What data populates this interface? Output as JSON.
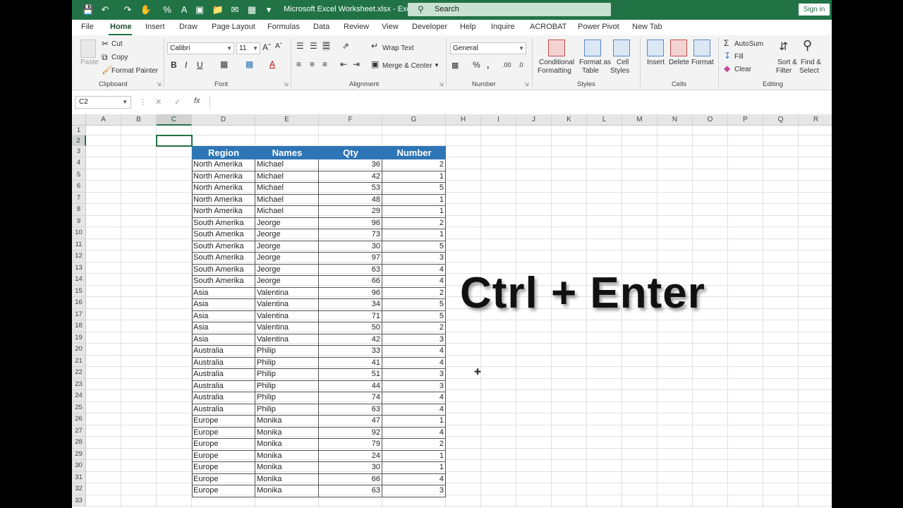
{
  "window": {
    "title": "Microsoft Excel Worksheet.xlsx  -  Excel",
    "search_placeholder": "Search",
    "signin_label": "Sign in"
  },
  "tabs": [
    "File",
    "Home",
    "Insert",
    "Draw",
    "Page Layout",
    "Formulas",
    "Data",
    "Review",
    "View",
    "Developer",
    "Help",
    "Inquire",
    "ACROBAT",
    "Power Pivot",
    "New Tab"
  ],
  "ribbon": {
    "clipboard": {
      "paste": "Paste",
      "cut": "Cut",
      "copy": "Copy",
      "format_painter": "Format Painter",
      "label": "Clipboard"
    },
    "font": {
      "name": "Calibri",
      "size": "11",
      "bold": "B",
      "italic": "I",
      "underline": "U",
      "label": "Font"
    },
    "alignment": {
      "wrap": "Wrap Text",
      "merge": "Merge & Center",
      "label": "Alignment"
    },
    "number": {
      "format": "General",
      "label": "Number"
    },
    "styles": {
      "conditional": "Conditional",
      "conditional2": "Formatting",
      "format_as": "Format as",
      "format_as2": "Table",
      "cell": "Cell",
      "cell2": "Styles",
      "label": "Styles"
    },
    "cells": {
      "insert": "Insert",
      "delete": "Delete",
      "format": "Format",
      "label": "Cells"
    },
    "editing": {
      "autosum": "AutoSum",
      "fill": "Fill",
      "clear": "Clear",
      "sort": "Sort &",
      "sort2": "Filter",
      "find": "Find &",
      "find2": "Select",
      "label": "Editing"
    }
  },
  "formula_bar": {
    "name_box": "C2",
    "fx": "fx",
    "value": ""
  },
  "columns": [
    "A",
    "B",
    "C",
    "D",
    "E",
    "F",
    "G",
    "H",
    "I",
    "J",
    "K",
    "L",
    "M",
    "N",
    "O",
    "P",
    "Q",
    "R"
  ],
  "rows": [
    "1",
    "2",
    "3",
    "4",
    "5",
    "6",
    "7",
    "8",
    "9",
    "10",
    "11",
    "12",
    "13",
    "14",
    "15",
    "16",
    "17",
    "18",
    "19",
    "20",
    "21",
    "22",
    "23",
    "24",
    "25",
    "26",
    "27",
    "28",
    "29",
    "30",
    "31",
    "32",
    "33"
  ],
  "table": {
    "headers": [
      "Region",
      "Names",
      "Qty",
      "Number"
    ],
    "rows": [
      [
        "North Amerika",
        "Michael",
        "36",
        "2"
      ],
      [
        "North Amerika",
        "Michael",
        "42",
        "1"
      ],
      [
        "North Amerika",
        "Michael",
        "53",
        "5"
      ],
      [
        "North Amerika",
        "Michael",
        "48",
        "1"
      ],
      [
        "North Amerika",
        "Michael",
        "29",
        "1"
      ],
      [
        "South Amerika",
        "Jeorge",
        "96",
        "2"
      ],
      [
        "South Amerika",
        "Jeorge",
        "73",
        "1"
      ],
      [
        "South Amerika",
        "Jeorge",
        "30",
        "5"
      ],
      [
        "South Amerika",
        "Jeorge",
        "97",
        "3"
      ],
      [
        "South Amerika",
        "Jeorge",
        "63",
        "4"
      ],
      [
        "South Amerika",
        "Jeorge",
        "66",
        "4"
      ],
      [
        "Asia",
        "Valentina",
        "96",
        "2"
      ],
      [
        "Asia",
        "Valentina",
        "34",
        "5"
      ],
      [
        "Asia",
        "Valentina",
        "71",
        "5"
      ],
      [
        "Asia",
        "Valentina",
        "50",
        "2"
      ],
      [
        "Asia",
        "Valentina",
        "42",
        "3"
      ],
      [
        "Australia",
        "Philip",
        "33",
        "4"
      ],
      [
        "Australia",
        "Philip",
        "41",
        "4"
      ],
      [
        "Australia",
        "Philip",
        "51",
        "3"
      ],
      [
        "Australia",
        "Philip",
        "44",
        "3"
      ],
      [
        "Australia",
        "Philip",
        "74",
        "4"
      ],
      [
        "Australia",
        "Philip",
        "63",
        "4"
      ],
      [
        "Europe",
        "Monika",
        "47",
        "1"
      ],
      [
        "Europe",
        "Monika",
        "92",
        "4"
      ],
      [
        "Europe",
        "Monika",
        "79",
        "2"
      ],
      [
        "Europe",
        "Monika",
        "24",
        "1"
      ],
      [
        "Europe",
        "Monika",
        "30",
        "1"
      ],
      [
        "Europe",
        "Monika",
        "66",
        "4"
      ],
      [
        "Europe",
        "Monika",
        "63",
        "3"
      ]
    ]
  },
  "overlay": "Ctrl + Enter",
  "selected_cell": "C2",
  "colors": {
    "excel_green": "#217346",
    "table_header": "#2e75b6"
  }
}
